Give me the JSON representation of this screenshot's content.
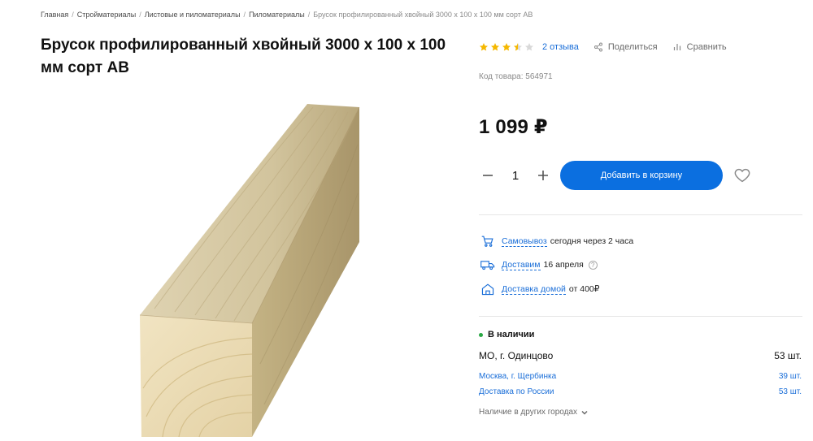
{
  "breadcrumb": {
    "items": [
      "Главная",
      "Стройматериалы",
      "Листовые и пиломатериалы",
      "Пиломатериалы"
    ],
    "current": "Брусок профилированный хвойный 3000 х 100 х 100 мм сорт АВ",
    "separator": "/"
  },
  "product": {
    "title": "Брусок профилированный хвойный 3000 х 100 х 100 мм сорт АВ",
    "rating": 3.5,
    "rating_max": 5,
    "reviews_label": "2 отзыва",
    "share_label": "Поделиться",
    "compare_label": "Сравнить",
    "sku_label": "Код товара: 564971",
    "price": "1 099 ₽"
  },
  "purchase": {
    "quantity": "1",
    "add_to_cart_label": "Добавить в корзину"
  },
  "delivery": {
    "pickup": {
      "link": "Самовывоз",
      "text": "сегодня через 2 часа",
      "icon": "pickup-cart-icon"
    },
    "courier": {
      "link": "Доставим",
      "text": "16 апреля",
      "hint": "?",
      "icon": "truck-icon"
    },
    "home": {
      "link": "Доставка домой",
      "text": "от 400₽",
      "icon": "house-icon"
    }
  },
  "stock": {
    "title": "В наличии",
    "main": {
      "name": "МО, г. Одинцово",
      "qty": "53 шт."
    },
    "others": [
      {
        "name": "Москва, г. Щербинка",
        "qty": "39 шт."
      },
      {
        "name": "Доставка по России",
        "qty": "53 шт."
      }
    ],
    "other_cities_label": "Наличие в других городах"
  },
  "colors": {
    "accent": "#0b6fe0",
    "link": "#1a6ed8",
    "star": "#f5b800",
    "in_stock": "#2aa845"
  }
}
